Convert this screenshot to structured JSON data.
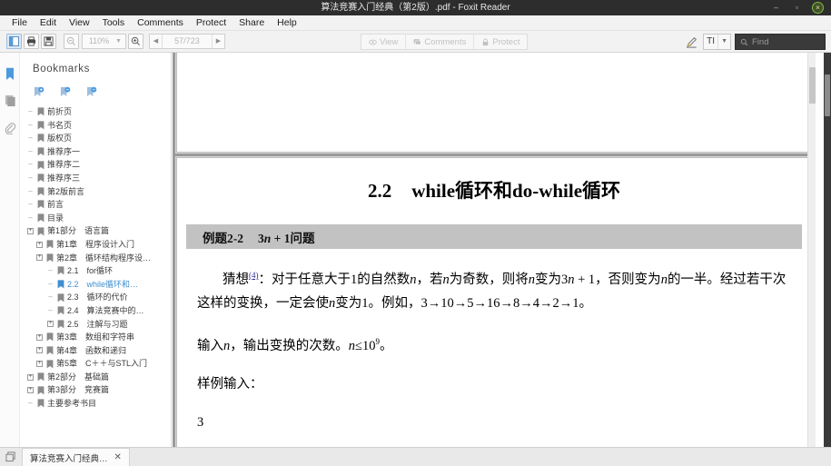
{
  "window": {
    "title": "算法竞赛入门经典（第2版）.pdf - Foxit Reader",
    "minimize": "–",
    "maximize": "▫",
    "close": "×"
  },
  "menubar": {
    "items": [
      "File",
      "Edit",
      "View",
      "Tools",
      "Comments",
      "Protect",
      "Share",
      "Help"
    ]
  },
  "toolbar": {
    "sidebar_toggle": "sidebar-toggle-icon",
    "print": "print-icon",
    "save": "save-icon",
    "zoom_out": "zoom-out-icon",
    "zoom_value": "110%",
    "zoom_caret": "▼",
    "zoom_in": "zoom-in-icon",
    "prev_page": "◀",
    "page_value": "57/723",
    "next_page": "▶",
    "mode_tabs": [
      {
        "label": "View",
        "icon": "eye-icon"
      },
      {
        "label": "Comments",
        "icon": "comment-icon"
      },
      {
        "label": "Protect",
        "icon": "lock-icon"
      }
    ],
    "pencil": "pencil-icon",
    "text_tool_label": "TI",
    "text_tool_caret": "▼",
    "find_placeholder": "Find",
    "find_icon": "search-icon",
    "find_value": ""
  },
  "rail": {
    "items": [
      {
        "name": "bookmarks-rail-icon",
        "active": true
      },
      {
        "name": "pages-rail-icon",
        "active": false
      },
      {
        "name": "attachments-rail-icon",
        "active": false
      }
    ]
  },
  "bookmarks": {
    "title": "Bookmarks",
    "tools": [
      "bookmark-expand-icon",
      "bookmark-collapse-icon",
      "bookmark-options-icon"
    ],
    "tree": [
      {
        "label": "前折页",
        "indent": 0,
        "twisty": "none",
        "selected": false
      },
      {
        "label": "书名页",
        "indent": 0,
        "twisty": "none",
        "selected": false
      },
      {
        "label": "版权页",
        "indent": 0,
        "twisty": "none",
        "selected": false
      },
      {
        "label": "推荐序一",
        "indent": 0,
        "twisty": "none",
        "selected": false
      },
      {
        "label": "推荐序二",
        "indent": 0,
        "twisty": "none",
        "selected": false
      },
      {
        "label": "推荐序三",
        "indent": 0,
        "twisty": "none",
        "selected": false
      },
      {
        "label": "第2版前言",
        "indent": 0,
        "twisty": "none",
        "selected": false
      },
      {
        "label": "前言",
        "indent": 0,
        "twisty": "none",
        "selected": false
      },
      {
        "label": "目录",
        "indent": 0,
        "twisty": "none",
        "selected": false
      },
      {
        "label": "第1部分　语言篇",
        "indent": 0,
        "twisty": "expand",
        "selected": false
      },
      {
        "label": "第1章　程序设计入门",
        "indent": 1,
        "twisty": "expand",
        "selected": false
      },
      {
        "label": "第2章　循环结构程序设…",
        "indent": 1,
        "twisty": "expand",
        "selected": false
      },
      {
        "label": "2.1　for循环",
        "indent": 2,
        "twisty": "none",
        "selected": false
      },
      {
        "label": "2.2　while循环和…",
        "indent": 2,
        "twisty": "none",
        "selected": true
      },
      {
        "label": "2.3　循环的代价",
        "indent": 2,
        "twisty": "none",
        "selected": false
      },
      {
        "label": "2.4　算法竞赛中的…",
        "indent": 2,
        "twisty": "none",
        "selected": false
      },
      {
        "label": "2.5　注解与习题",
        "indent": 2,
        "twisty": "expand",
        "selected": false
      },
      {
        "label": "第3章　数组和字符串",
        "indent": 1,
        "twisty": "expand",
        "selected": false
      },
      {
        "label": "第4章　函数和递归",
        "indent": 1,
        "twisty": "expand",
        "selected": false
      },
      {
        "label": "第5章　C＋＋与STL入门",
        "indent": 1,
        "twisty": "expand",
        "selected": false
      },
      {
        "label": "第2部分　基础篇",
        "indent": 0,
        "twisty": "expand",
        "selected": false
      },
      {
        "label": "第3部分　竞赛篇",
        "indent": 0,
        "twisty": "expand",
        "selected": false
      },
      {
        "label": "主要参考书目",
        "indent": 0,
        "twisty": "none",
        "selected": false
      }
    ]
  },
  "document": {
    "heading_number": "2.2",
    "heading_title": "while循环和do-while循环",
    "example_label": "例题2-2",
    "example_title_pre": "3",
    "example_title_var": "n",
    "example_title_post": " + 1问题",
    "paragraph1_a": "猜想",
    "paragraph1_sup": "(4)",
    "paragraph1_b": "：对于任意大于1的自然数",
    "paragraph1_var1": "n",
    "paragraph1_c": "，若",
    "paragraph1_var2": "n",
    "paragraph1_d": "为奇数，则将",
    "paragraph1_var3": "n",
    "paragraph1_e": "变为3",
    "paragraph1_var4": "n",
    "paragraph1_f": " + 1，否则变为",
    "paragraph1_var5": "n",
    "paragraph1_g": "的一半。经过若干次这样的变换，一定会使",
    "paragraph1_var6": "n",
    "paragraph1_h": "变为1。例如，3→10→5→16→8→4→2→1。",
    "paragraph2_a": "输入",
    "paragraph2_var": "n",
    "paragraph2_b": "，输出变换的次数。",
    "paragraph2_var2": "n",
    "paragraph2_c": "≤10",
    "paragraph2_sup": "9",
    "paragraph2_d": "。",
    "sample_input_label": "样例输入：",
    "sample_input_value": "3"
  },
  "tabbar": {
    "left_icon": "window-list-icon",
    "tab_label": "算法竞赛入门经典…",
    "tab_close": "✕"
  }
}
